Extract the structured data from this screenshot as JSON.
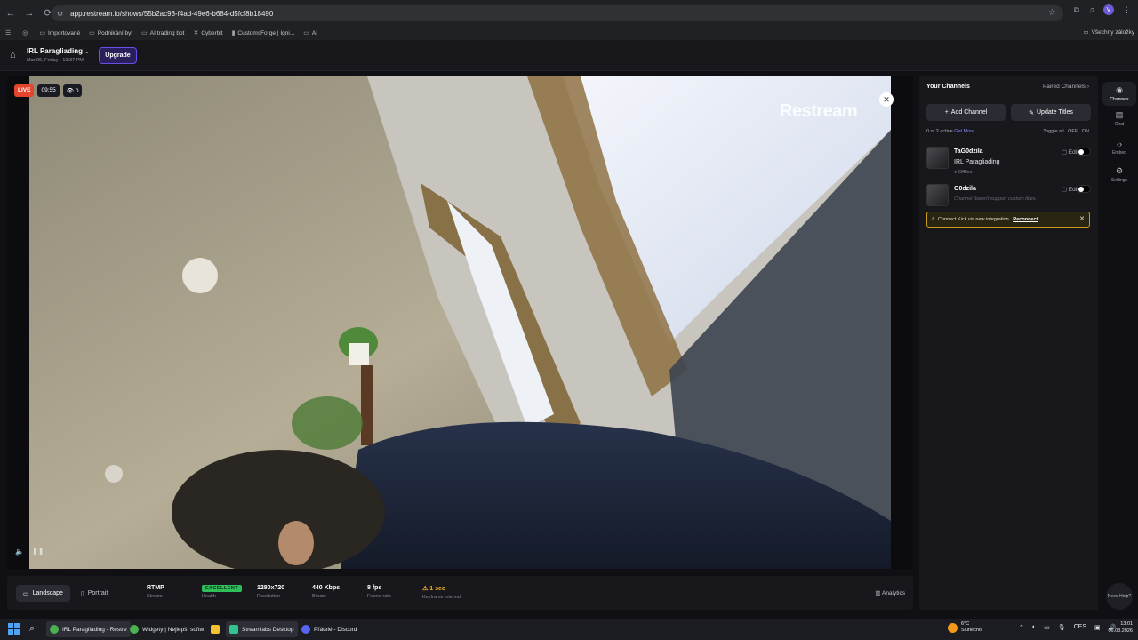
{
  "browser": {
    "url": "app.restream.io/shows/55b2ac93-f4ad-49e6-b684-d5fcf8b18490",
    "bookmarks": [
      "Importované",
      "Podnikání byt",
      "AI trading bot",
      "Cyberbit",
      "CustomsForge | Igni...",
      "AI"
    ],
    "bookmarks_right": "Všechny záložky"
  },
  "header": {
    "show_title": "IRL Paragliading",
    "show_date": "Mar 06, Friday - 12:37 PM",
    "upgrade_label": "Upgrade"
  },
  "player": {
    "live_label": "LIVE",
    "timer": "09:55",
    "viewers": "0",
    "watermark": "Restream"
  },
  "stats": {
    "landscape_label": "Landscape",
    "portrait_label": "Portrait",
    "items": [
      {
        "value": "RTMP",
        "label": "Stream"
      },
      {
        "value": "EXCELLENT",
        "label": "Health"
      },
      {
        "value": "1280x720",
        "label": "Resolution"
      },
      {
        "value": "440 Kbps",
        "label": "Bitrate"
      },
      {
        "value": "8 fps",
        "label": "Frame rate"
      },
      {
        "value": "1 sec",
        "label": "Keyframe interval"
      }
    ],
    "analytics_label": "Analytics"
  },
  "panel": {
    "title": "Your Channels",
    "paired_label": "Paired Channels",
    "add_channel": "Add Channel",
    "update_titles": "Update Titles",
    "active_text": "0 of 2 active",
    "get_more": "Get More",
    "toggle_all": "Toggle all",
    "off": "OFF",
    "on": "ON",
    "channels": [
      {
        "name": "TaG0dzila",
        "title": "IRL Paragliading",
        "status": "Offline",
        "edit": "Edit"
      },
      {
        "name": "G0dzila",
        "note": "Channel doesn't support custom titles.",
        "edit": "Edit"
      }
    ],
    "alert_text": "Connect Kick via new integration.",
    "alert_link": "Reconnect"
  },
  "sidebar": {
    "items": [
      {
        "label": "Channels",
        "icon": "broadcast-icon"
      },
      {
        "label": "Chat",
        "icon": "chat-icon"
      },
      {
        "label": "Embed",
        "icon": "code-icon"
      },
      {
        "label": "Settings",
        "icon": "gear-icon"
      }
    ],
    "help": "Need Help?"
  },
  "taskbar": {
    "apps": [
      {
        "label": "IRL Paragliading - Restre"
      },
      {
        "label": "Widgety | Nejlepší softw"
      },
      {
        "label": "Streamlabs Desktop"
      },
      {
        "label": "Přátelé - Discord"
      }
    ],
    "weather_temp": "6°C",
    "weather_desc": "Slunečno",
    "lang": "CES",
    "time": "13:01",
    "date": "06.03.2026"
  }
}
